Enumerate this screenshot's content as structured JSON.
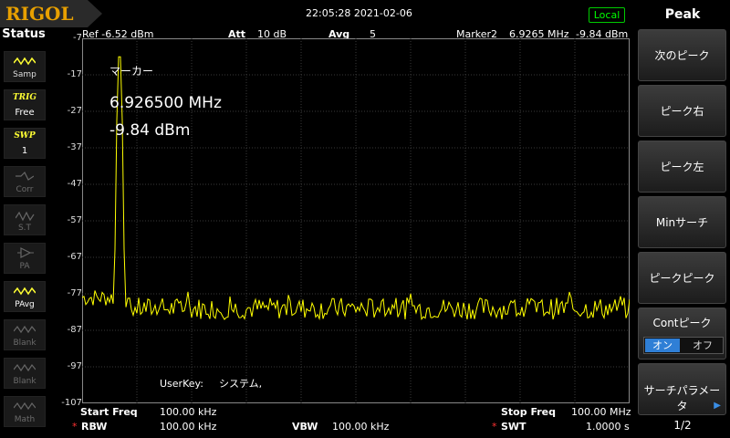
{
  "topbar": {
    "logo": "RIGOL",
    "datetime": "22:05:28 2021-02-06",
    "remote_status": "Local"
  },
  "status_panel": {
    "title": "Status",
    "items": [
      {
        "label": "Samp",
        "active": true,
        "icon": "wave-samp-icon"
      },
      {
        "label": "Free",
        "active": true,
        "header": "TRIG"
      },
      {
        "label": "1",
        "active": true,
        "header": "SWP"
      },
      {
        "label": "Corr",
        "active": false,
        "icon": "corr-icon"
      },
      {
        "label": "S.T",
        "active": false,
        "icon": "st-icon"
      },
      {
        "label": "PA",
        "active": false,
        "icon": "pa-icon"
      },
      {
        "label": "PAvg",
        "active": true,
        "icon": "pavg-icon"
      },
      {
        "label": "Blank",
        "active": false,
        "icon": "trace-icon"
      },
      {
        "label": "Blank",
        "active": false,
        "icon": "trace-icon"
      },
      {
        "label": "Math",
        "active": false,
        "icon": "trace-icon"
      }
    ]
  },
  "header": {
    "ref": "Ref -6.52 dBm",
    "att_label": "Att",
    "att_value": "10 dB",
    "avg_label": "Avg",
    "avg_value": "5",
    "marker_label": "Marker2",
    "marker_freq": "6.9265 MHz",
    "marker_level": "-9.84 dBm"
  },
  "chart_data": {
    "type": "line",
    "title": "",
    "xlabel": "",
    "ylabel": "",
    "xlim": [
      100,
      100
    ],
    "ylim": [
      -107,
      -7
    ],
    "y_ticks": [
      "-7",
      "-17",
      "-27",
      "-37",
      "-47",
      "-57",
      "-67",
      "-77",
      "-87",
      "-97",
      "-107"
    ],
    "trace_color": "#ffff00",
    "noise_floor_dbm": -81,
    "peak": {
      "freq_mhz": 6.9265,
      "level_dbm": -9.84
    },
    "grid": true
  },
  "marker_box": {
    "title": "マーカー",
    "freq": "6.926500 MHz",
    "level": "-9.84 dBm",
    "marker_number": "2"
  },
  "userkey": {
    "label": "UserKey:",
    "value": "システム,"
  },
  "footer": {
    "start_label": "Start Freq",
    "start_value": "100.00 kHz",
    "stop_label": "Stop Freq",
    "stop_value": "100.00 MHz",
    "rbw_label": "RBW",
    "rbw_value": "100.00 kHz",
    "vbw_label": "VBW",
    "vbw_value": "100.00 kHz",
    "swt_label": "SWT",
    "swt_value": "1.0000 s"
  },
  "menu": {
    "title": "Peak",
    "items": [
      "次のピーク",
      "ピーク右",
      "ピーク左",
      "Minサーチ",
      "ピークピーク"
    ],
    "cont_peak_label": "Contピーク",
    "cont_on": "オン",
    "cont_off": "オフ",
    "search_params": "サーチパラメータ",
    "page": "1/2"
  }
}
